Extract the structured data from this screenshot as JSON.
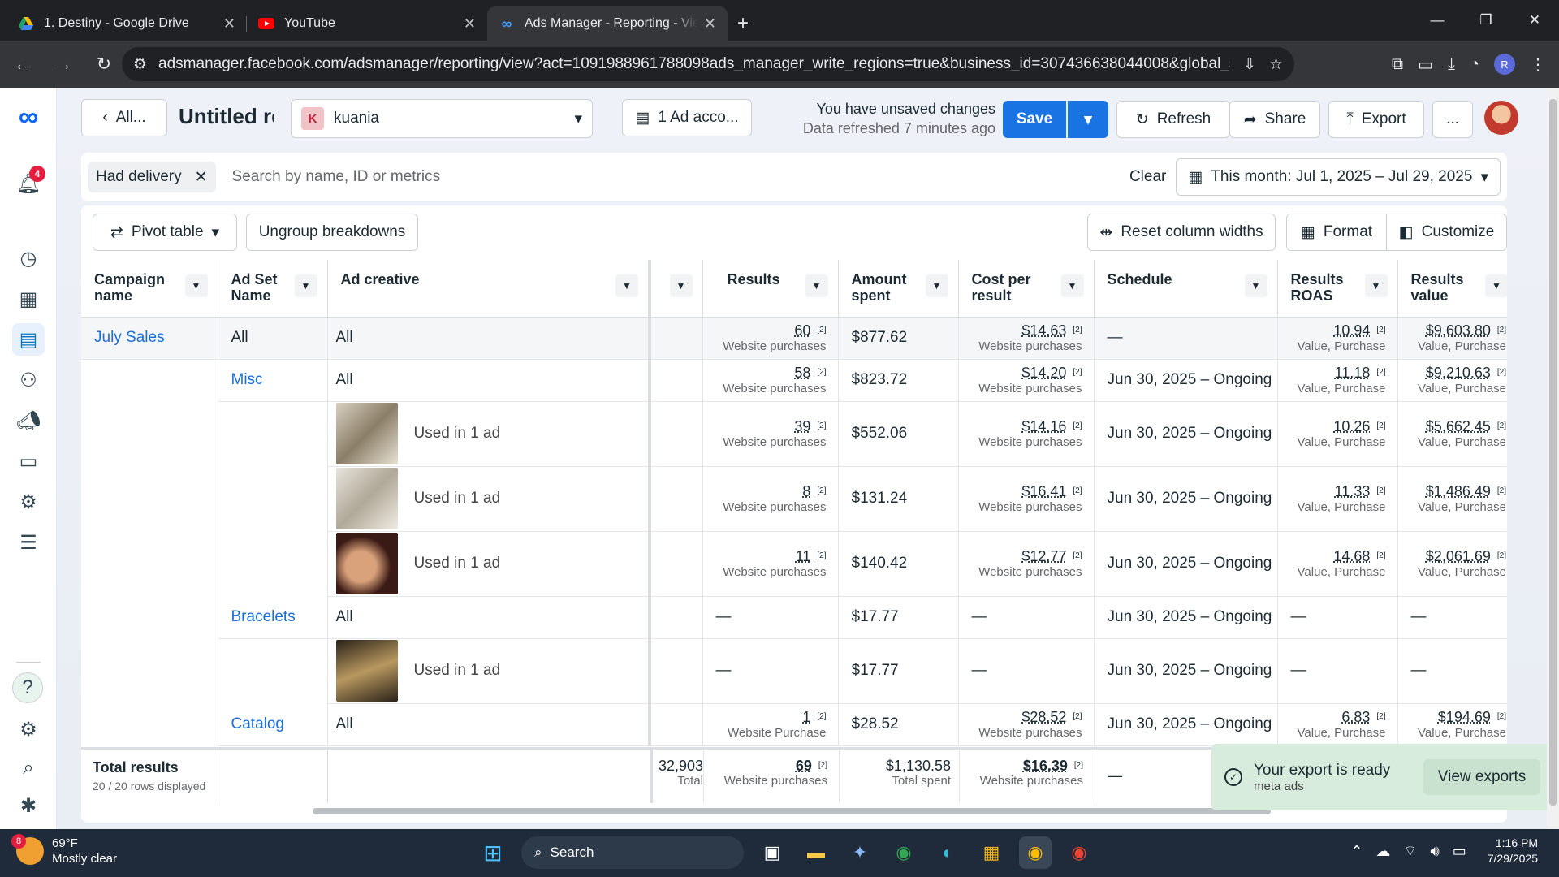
{
  "tabs": [
    {
      "title": "1. Destiny - Google Drive"
    },
    {
      "title": "YouTube"
    },
    {
      "title": "Ads Manager - Reporting - View"
    }
  ],
  "address": {
    "url": "adsmanager.facebook.com/adsmanager/reporting/view?act=1091988961788098ads_manager_write_regions=true&business_id=307436638044008&global_scope_id=..."
  },
  "browser": {
    "profile": "R"
  },
  "rail": {
    "notif_count": "4"
  },
  "header": {
    "back": "All...",
    "title": "Untitled report",
    "account_initial": "K",
    "account": "kuania",
    "ad_accounts": "1 Ad acco...",
    "unsaved": "You have unsaved changes",
    "refreshed": "Data refreshed 7 minutes ago",
    "save": "Save",
    "refresh": "Refresh",
    "share": "Share",
    "export": "Export",
    "more": "..."
  },
  "filters": {
    "chip": "Had delivery",
    "placeholder": "Search by name, ID or metrics",
    "clear": "Clear",
    "date": "This month: Jul 1, 2025 – Jul 29, 2025"
  },
  "toolbar": {
    "pivot": "Pivot table",
    "ungroup": "Ungroup breakdowns",
    "reset": "Reset column widths",
    "format": "Format",
    "customize": "Customize"
  },
  "columns": {
    "campaign": "Campaign name",
    "adset": "Ad Set Name",
    "creative": "Ad creative",
    "results": "Results",
    "amount": "Amount spent",
    "cpr": "Cost per result",
    "schedule": "Schedule",
    "roas": "Results ROAS",
    "value": "Results value"
  },
  "rows": [
    {
      "campaign": "July Sales",
      "adset": "All",
      "creative": "All",
      "results": "60",
      "res_lbl": "Website purchases",
      "amount": "$877.62",
      "cpr": "$14.63",
      "cpr_lbl": "Website purchases",
      "schedule": "—",
      "roas": "10.94",
      "roas_lbl": "Value, Purchase",
      "value": "$9,603.80",
      "val_lbl": "Value, Purchase"
    },
    {
      "campaign": "",
      "adset": "Misc",
      "creative": "All",
      "results": "58",
      "res_lbl": "Website purchases",
      "amount": "$823.72",
      "cpr": "$14.20",
      "cpr_lbl": "Website purchases",
      "schedule": "Jun 30, 2025 – Ongoing",
      "roas": "11.18",
      "roas_lbl": "Value, Purchase",
      "value": "$9,210.63",
      "val_lbl": "Value, Purchase"
    },
    {
      "campaign": "",
      "adset": "",
      "creative": "Used in 1 ad",
      "results": "39",
      "res_lbl": "Website purchases",
      "amount": "$552.06",
      "cpr": "$14.16",
      "cpr_lbl": "Website purchases",
      "schedule": "Jun 30, 2025 – Ongoing",
      "roas": "10.26",
      "roas_lbl": "Value, Purchase",
      "value": "$5,662.45",
      "val_lbl": "Value, Purchase"
    },
    {
      "campaign": "",
      "adset": "",
      "creative": "Used in 1 ad",
      "results": "8",
      "res_lbl": "Website purchases",
      "amount": "$131.24",
      "cpr": "$16.41",
      "cpr_lbl": "Website purchases",
      "schedule": "Jun 30, 2025 – Ongoing",
      "roas": "11.33",
      "roas_lbl": "Value, Purchase",
      "value": "$1,486.49",
      "val_lbl": "Value, Purchase"
    },
    {
      "campaign": "",
      "adset": "",
      "creative": "Used in 1 ad",
      "results": "11",
      "res_lbl": "Website purchases",
      "amount": "$140.42",
      "cpr": "$12.77",
      "cpr_lbl": "Website purchases",
      "schedule": "Jun 30, 2025 – Ongoing",
      "roas": "14.68",
      "roas_lbl": "Value, Purchase",
      "value": "$2,061.69",
      "val_lbl": "Value, Purchase"
    },
    {
      "campaign": "",
      "adset": "Bracelets",
      "creative": "All",
      "results": "—",
      "res_lbl": "",
      "amount": "$17.77",
      "cpr": "—",
      "cpr_lbl": "",
      "schedule": "Jun 30, 2025 – Ongoing",
      "roas": "—",
      "roas_lbl": "",
      "value": "—",
      "val_lbl": ""
    },
    {
      "campaign": "",
      "adset": "",
      "creative": "Used in 1 ad",
      "results": "—",
      "res_lbl": "",
      "amount": "$17.77",
      "cpr": "—",
      "cpr_lbl": "",
      "schedule": "Jun 30, 2025 – Ongoing",
      "roas": "—",
      "roas_lbl": "",
      "value": "—",
      "val_lbl": ""
    },
    {
      "campaign": "",
      "adset": "Catalog",
      "creative": "All",
      "results": "1",
      "res_lbl": "Website Purchase",
      "amount": "$28.52",
      "cpr": "$28.52",
      "cpr_lbl": "Website purchases",
      "schedule": "Jun 30, 2025 – Ongoing",
      "roas": "6.83",
      "roas_lbl": "Value, Purchase",
      "value": "$194.69",
      "val_lbl": "Value, Purchase"
    }
  ],
  "note_sup": "[2]",
  "totals": {
    "label": "Total results",
    "sub": "20 / 20 rows displayed",
    "hidden": "32,903",
    "hidden_lbl": "Total",
    "results": "69",
    "res_lbl": "Website purchases",
    "amount": "$1,130.58",
    "amount_lbl": "Total spent",
    "cpr": "$16.39",
    "cpr_lbl": "Website purchases",
    "schedule": "—"
  },
  "toast": {
    "title": "Your export is ready",
    "sub": "meta ads",
    "action": "View exports"
  },
  "taskbar": {
    "weather_badge": "8",
    "temp": "69°F",
    "weather": "Mostly clear",
    "search": "Search",
    "time": "1:16 PM",
    "date": "7/29/2025"
  }
}
